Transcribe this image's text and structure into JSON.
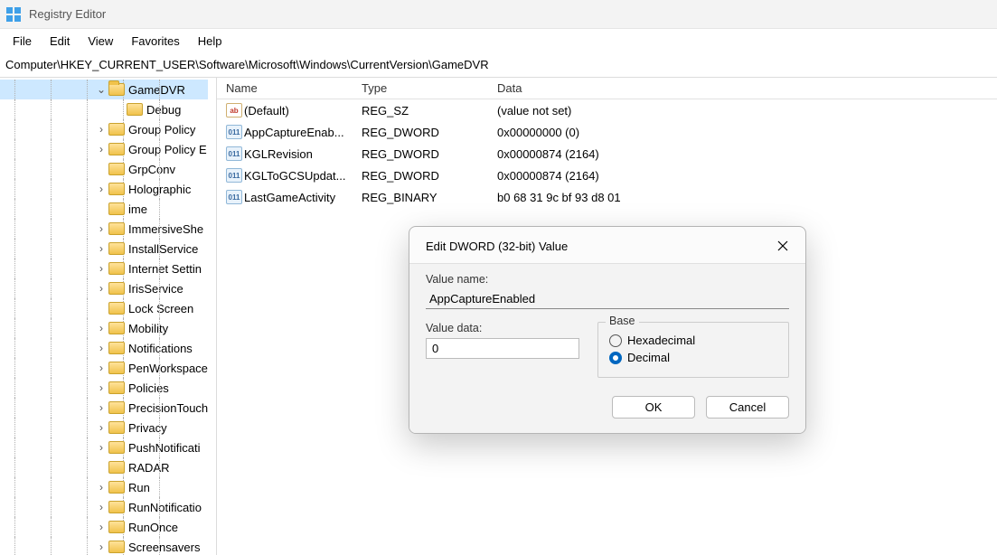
{
  "window": {
    "title": "Registry Editor"
  },
  "menu": {
    "file": "File",
    "edit": "Edit",
    "view": "View",
    "favorites": "Favorites",
    "help": "Help"
  },
  "address": "Computer\\HKEY_CURRENT_USER\\Software\\Microsoft\\Windows\\CurrentVersion\\GameDVR",
  "tree": {
    "items": [
      {
        "indent": 104,
        "exp": "v",
        "label": "GameDVR",
        "selected": true,
        "open": true
      },
      {
        "indent": 124,
        "exp": "",
        "label": "Debug"
      },
      {
        "indent": 104,
        "exp": ">",
        "label": "Group Policy"
      },
      {
        "indent": 104,
        "exp": ">",
        "label": "Group Policy E"
      },
      {
        "indent": 104,
        "exp": "",
        "label": "GrpConv"
      },
      {
        "indent": 104,
        "exp": ">",
        "label": "Holographic"
      },
      {
        "indent": 104,
        "exp": "",
        "label": "ime"
      },
      {
        "indent": 104,
        "exp": ">",
        "label": "ImmersiveShe"
      },
      {
        "indent": 104,
        "exp": ">",
        "label": "InstallService"
      },
      {
        "indent": 104,
        "exp": ">",
        "label": "Internet Settin"
      },
      {
        "indent": 104,
        "exp": ">",
        "label": "IrisService"
      },
      {
        "indent": 104,
        "exp": "",
        "label": "Lock Screen"
      },
      {
        "indent": 104,
        "exp": ">",
        "label": "Mobility"
      },
      {
        "indent": 104,
        "exp": ">",
        "label": "Notifications"
      },
      {
        "indent": 104,
        "exp": ">",
        "label": "PenWorkspace"
      },
      {
        "indent": 104,
        "exp": ">",
        "label": "Policies"
      },
      {
        "indent": 104,
        "exp": ">",
        "label": "PrecisionTouch"
      },
      {
        "indent": 104,
        "exp": ">",
        "label": "Privacy"
      },
      {
        "indent": 104,
        "exp": ">",
        "label": "PushNotificati"
      },
      {
        "indent": 104,
        "exp": "",
        "label": "RADAR"
      },
      {
        "indent": 104,
        "exp": ">",
        "label": "Run"
      },
      {
        "indent": 104,
        "exp": ">",
        "label": "RunNotificatio"
      },
      {
        "indent": 104,
        "exp": ">",
        "label": "RunOnce"
      },
      {
        "indent": 104,
        "exp": ">",
        "label": "Screensavers"
      }
    ]
  },
  "list": {
    "headers": {
      "name": "Name",
      "type": "Type",
      "data": "Data"
    },
    "rows": [
      {
        "icon": "sz",
        "name": "(Default)",
        "type": "REG_SZ",
        "data": "(value not set)"
      },
      {
        "icon": "bin",
        "name": "AppCaptureEnab...",
        "type": "REG_DWORD",
        "data": "0x00000000 (0)"
      },
      {
        "icon": "bin",
        "name": "KGLRevision",
        "type": "REG_DWORD",
        "data": "0x00000874 (2164)"
      },
      {
        "icon": "bin",
        "name": "KGLToGCSUpdat...",
        "type": "REG_DWORD",
        "data": "0x00000874 (2164)"
      },
      {
        "icon": "bin",
        "name": "LastGameActivity",
        "type": "REG_BINARY",
        "data": "b0 68 31 9c bf 93 d8 01"
      }
    ]
  },
  "dialog": {
    "title": "Edit DWORD (32-bit) Value",
    "value_name_label": "Value name:",
    "value_name": "AppCaptureEnabled",
    "value_data_label": "Value data:",
    "value_data": "0",
    "base_label": "Base",
    "hex_label": "Hexadecimal",
    "dec_label": "Decimal",
    "base_selected": "decimal",
    "ok": "OK",
    "cancel": "Cancel"
  }
}
